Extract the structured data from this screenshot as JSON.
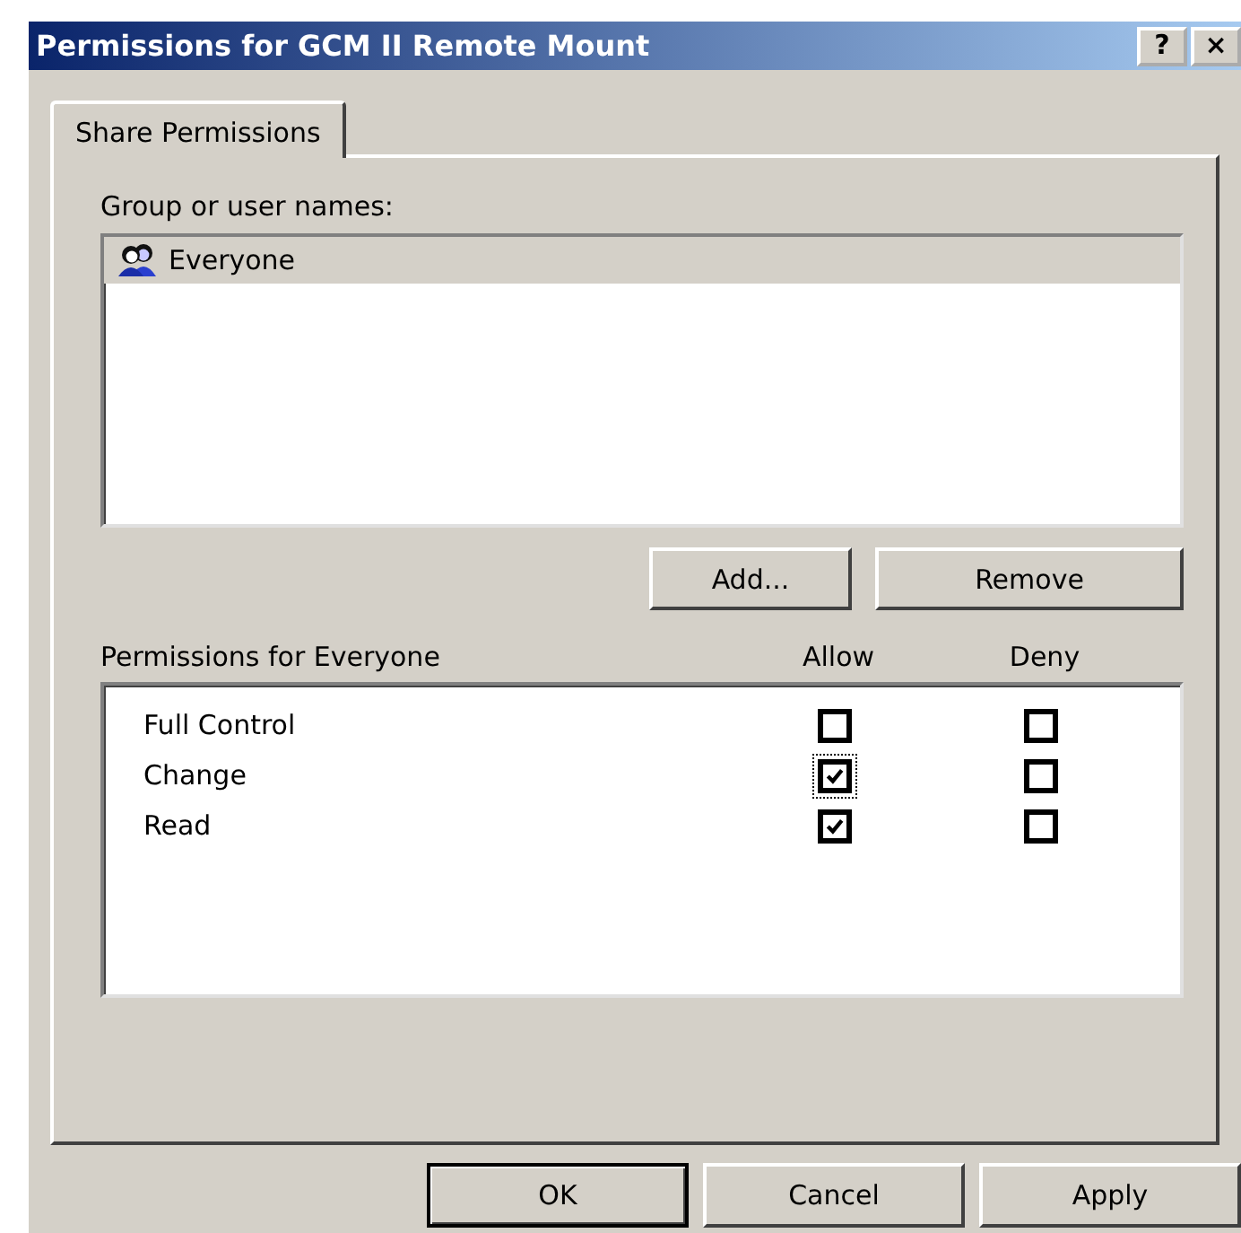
{
  "window": {
    "title": "Permissions for GCM II Remote Mount",
    "buttons": [
      "?",
      "×"
    ]
  },
  "tabs": [
    {
      "label": "Share Permissions",
      "selected": true
    }
  ],
  "group_list": {
    "label": "Group or user names:",
    "items": [
      {
        "name": "Everyone",
        "selected": true
      }
    ]
  },
  "group_buttons": [
    "Add...",
    "Remove"
  ],
  "permissions": {
    "label": "Permissions for Everyone",
    "columns": [
      "Allow",
      "Deny"
    ],
    "rows": [
      {
        "name": "Full Control",
        "allow": false,
        "deny": false,
        "focused": false
      },
      {
        "name": "Change",
        "allow": true,
        "deny": false,
        "focused": true
      },
      {
        "name": "Read",
        "allow": true,
        "deny": false,
        "focused": false
      }
    ]
  },
  "buttons": [
    {
      "label": "OK",
      "default": true
    },
    {
      "label": "Cancel",
      "default": false
    },
    {
      "label": "Apply",
      "default": false
    }
  ]
}
